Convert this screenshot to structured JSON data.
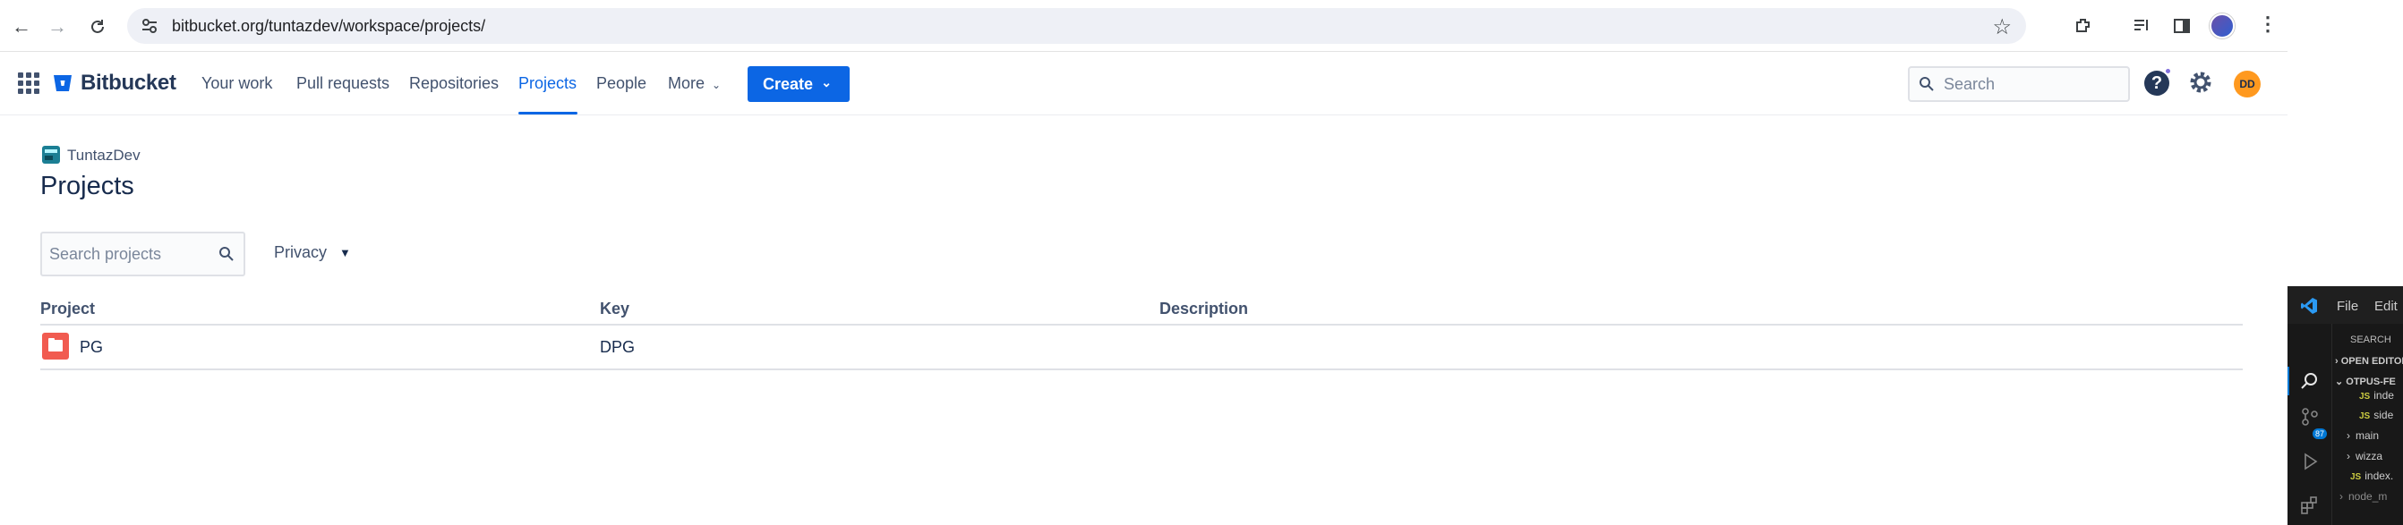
{
  "browser": {
    "url": "bitbucket.org/tuntazdev/workspace/projects/",
    "back_icon": "arrow-left-icon",
    "forward_icon": "arrow-right-icon",
    "reload_icon": "reload-icon"
  },
  "header": {
    "brand": "Bitbucket",
    "nav": {
      "your_work": "Your work",
      "pull_requests": "Pull requests",
      "repositories": "Repositories",
      "projects": "Projects",
      "people": "People",
      "more": "More"
    },
    "create_label": "Create",
    "search_placeholder": "Search",
    "help_label": "?",
    "avatar_initials": "DD",
    "accent_color": "#0c66e4"
  },
  "page": {
    "workspace_name": "TuntazDev",
    "title": "Projects",
    "search_placeholder": "Search projects",
    "privacy_label": "Privacy",
    "table": {
      "columns": [
        "Project",
        "Key",
        "Description"
      ],
      "rows": [
        {
          "project": "PG",
          "key": "DPG",
          "description": ""
        }
      ]
    }
  },
  "vscode": {
    "menu": [
      "File",
      "Edit"
    ],
    "search_header": "SEARCH",
    "open_editors": "OPEN EDITORS",
    "project": "OTPUS-FE",
    "badge": "87",
    "files": [
      "inde",
      "side",
      "main",
      "wizza",
      "index.",
      "node_m"
    ]
  }
}
